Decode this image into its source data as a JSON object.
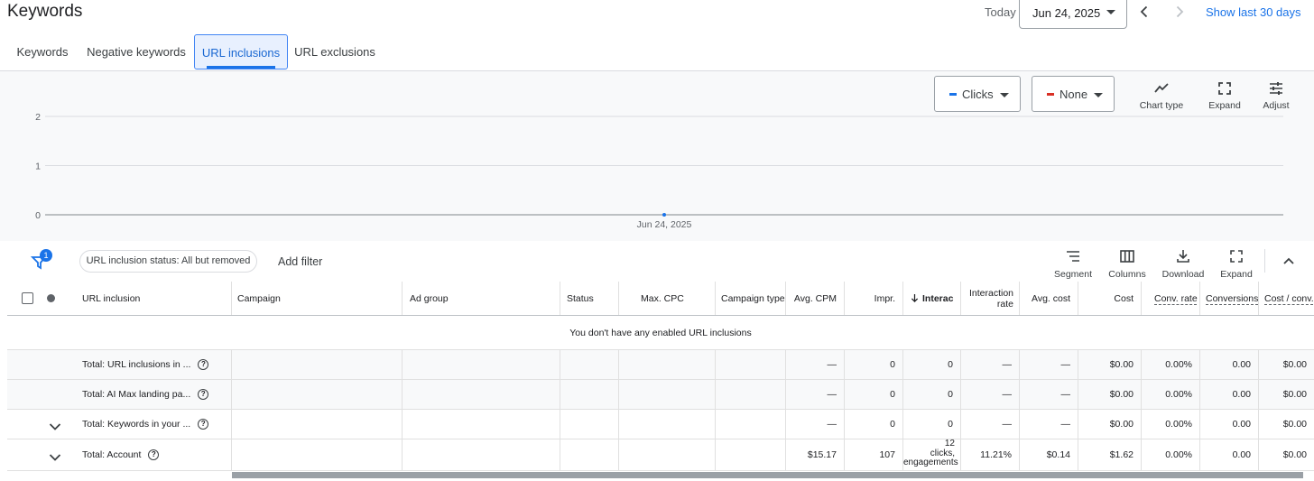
{
  "header": {
    "title": "Keywords",
    "today_label": "Today",
    "date": "Jun 24, 2025",
    "show_last": "Show last 30 days"
  },
  "tabs": [
    {
      "label": "Keywords"
    },
    {
      "label": "Negative keywords"
    },
    {
      "label": "URL inclusions",
      "active": true
    },
    {
      "label": "URL exclusions"
    }
  ],
  "chart_panel": {
    "metric1": {
      "label": "Clicks",
      "color": "#1a73e8"
    },
    "metric2": {
      "label": "None",
      "color": "#d93025"
    },
    "tools": {
      "chart_type": "Chart type",
      "expand": "Expand",
      "adjust": "Adjust"
    }
  },
  "chart_data": {
    "type": "line",
    "x": [
      "Jun 24, 2025"
    ],
    "series": [
      {
        "name": "Clicks",
        "values": [
          0
        ]
      }
    ],
    "ylim": [
      0,
      2
    ],
    "yticks": [
      "0",
      "1",
      "2"
    ],
    "xticks": [
      "Jun 24, 2025"
    ],
    "grid": true
  },
  "table_toolbar": {
    "filter_count": "1",
    "filter_chip": "URL inclusion status: All but removed",
    "add_filter": "Add filter",
    "segment": "Segment",
    "columns": "Columns",
    "download": "Download",
    "expand": "Expand"
  },
  "columns": {
    "url_inclusion": "URL inclusion",
    "campaign": "Campaign",
    "ad_group": "Ad group",
    "status": "Status",
    "max_cpc": "Max. CPC",
    "campaign_type": "Campaign type",
    "avg_cpm": "Avg. CPM",
    "impr": "Impr.",
    "interactions": "Interac",
    "interaction_rate": "Interaction rate",
    "avg_cost": "Avg. cost",
    "cost": "Cost",
    "conv_rate": "Conv. rate",
    "conversions": "Conversions",
    "cost_conv": "Cost / conv."
  },
  "empty_message": "You don't have any enabled URL inclusions",
  "rows": [
    {
      "label": "Total: URL inclusions in ...",
      "avg_cpm": "—",
      "impr": "0",
      "interactions": "0",
      "interaction_rate": "—",
      "avg_cost": "—",
      "cost": "$0.00",
      "conv_rate": "0.00%",
      "conversions": "0.00",
      "cost_conv": "$0.00"
    },
    {
      "label": "Total: AI Max landing pa...",
      "avg_cpm": "—",
      "impr": "0",
      "interactions": "0",
      "interaction_rate": "—",
      "avg_cost": "—",
      "cost": "$0.00",
      "conv_rate": "0.00%",
      "conversions": "0.00",
      "cost_conv": "$0.00"
    },
    {
      "label": "Total: Keywords in your ...",
      "avg_cpm": "—",
      "impr": "0",
      "interactions": "0",
      "interaction_rate": "—",
      "avg_cost": "—",
      "cost": "$0.00",
      "conv_rate": "0.00%",
      "conversions": "0.00",
      "cost_conv": "$0.00"
    },
    {
      "label": "Total: Account",
      "avg_cpm": "$15.17",
      "impr": "107",
      "interactions_num": "12",
      "interactions_l2": "clicks,",
      "interactions_l3": "engagements",
      "interaction_rate": "11.21%",
      "avg_cost": "$0.14",
      "cost": "$1.62",
      "conv_rate": "0.00%",
      "conversions": "0.00",
      "cost_conv": "$0.00"
    }
  ]
}
